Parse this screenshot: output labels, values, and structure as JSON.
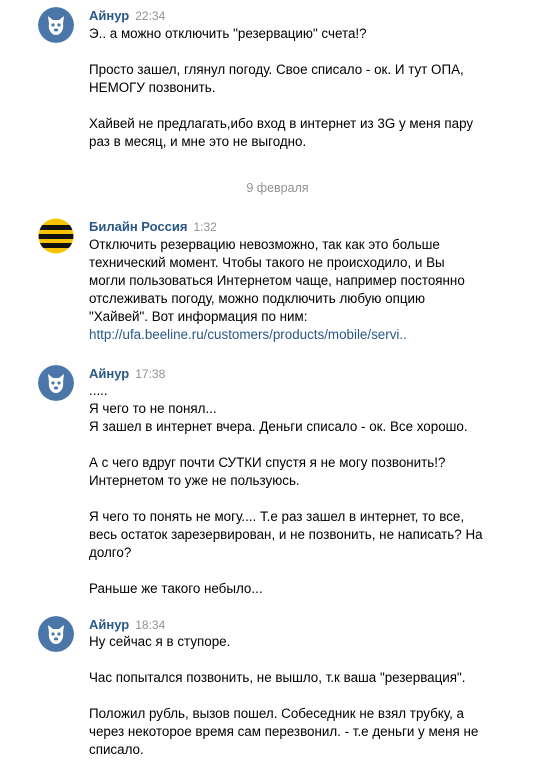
{
  "messages": [
    {
      "author": "Айнур",
      "time": "22:34",
      "avatar_icon": "vk-dog-avatar",
      "lines": [
        "Э.. а можно отключить \"резервацию\" счета!?",
        "",
        "Просто зашел, глянул погоду. Свое списало - ок. И тут ОПА,",
        "НЕМОГУ позвонить.",
        "",
        "Хайвей не предлагать,ибо вход в интернет из 3G у меня пару",
        "раз в месяц, и мне это не выгодно."
      ]
    },
    {
      "author": "Билайн Россия",
      "time": "1:32",
      "avatar_icon": "beeline-logo",
      "lines": [
        "Отключить резервацию невозможно, так как это больше",
        "технический момент. Чтобы такого не происходило, и Вы",
        "могли пользоваться Интернетом чаще, например постоянно",
        "отслеживать погоду, можно подключить любую опцию",
        "\"Хайвей\". Вот информация по ним:"
      ],
      "link": "http://ufa.beeline.ru/customers/products/mobile/servi.."
    },
    {
      "author": "Айнур",
      "time": "17:38",
      "avatar_icon": "vk-dog-avatar",
      "lines": [
        ".....",
        "Я чего то не понял...",
        "Я зашел в интернет вчера. Деньги списало - ок. Все хорошо.",
        "",
        "А с чего вдруг почти СУТКИ спустя я не могу позвонить!?",
        "Интернетом то уже не пользуюсь.",
        "",
        "Я чего то понять не могу.... Т.е раз зашел в интернет, то все,",
        "весь остаток зарезервирован, и не позвонить, не написать? На",
        "долго?",
        "",
        "Раньше же такого небыло..."
      ]
    },
    {
      "author": "Айнур",
      "time": "18:34",
      "avatar_icon": "vk-dog-avatar",
      "lines": [
        "Ну сейчас я в ступоре.",
        "",
        "Час попытался позвонить, не вышло, т.к ваша \"резервация\".",
        "",
        "Положил рубль, вызов пошел. Собеседник не взял трубку, а",
        "через некоторое время сам перезвонил. - т.е деньги у меня не",
        "списало."
      ]
    }
  ],
  "date_separator": "9 февраля",
  "colors": {
    "author": "#2a5885",
    "time": "#939393",
    "link": "#2a5885",
    "avatar_bg": "#4a76a8",
    "beeline_yellow": "#f8c300"
  }
}
